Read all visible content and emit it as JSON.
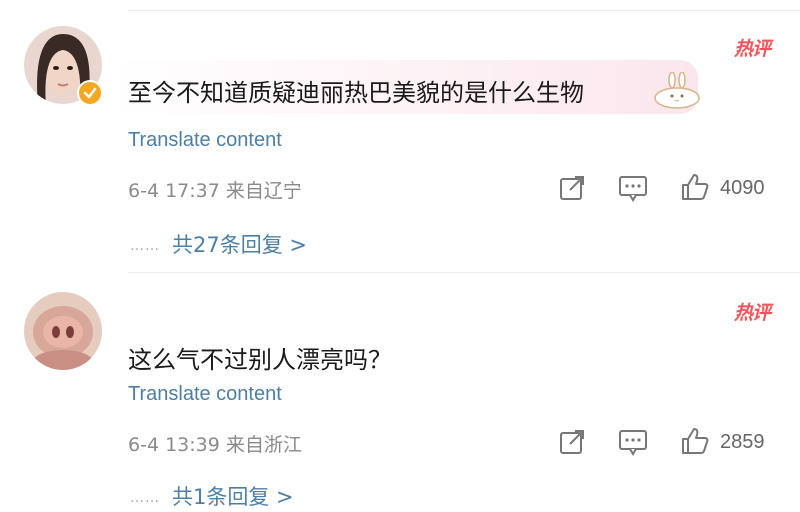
{
  "comments": [
    {
      "badge": "热评",
      "text": "至今不知道质疑迪丽热巴美貌的是什么生物",
      "translate": "Translate content",
      "meta": "6-4 17:37 来自辽宁",
      "likes": "4090",
      "replies": "共27条回复 >",
      "verified": true
    },
    {
      "badge": "热评",
      "text": "这么气不过别人漂亮吗？",
      "translate": "Translate content",
      "meta": "6-4 13:39 来自浙江",
      "likes": "2859",
      "replies": "共1条回复 >",
      "verified": false
    }
  ],
  "ellipsis": "……",
  "colors": {
    "accent_link": "#4d7fa6",
    "hot_badge": "#f2555b",
    "verified": "#f5a623"
  }
}
